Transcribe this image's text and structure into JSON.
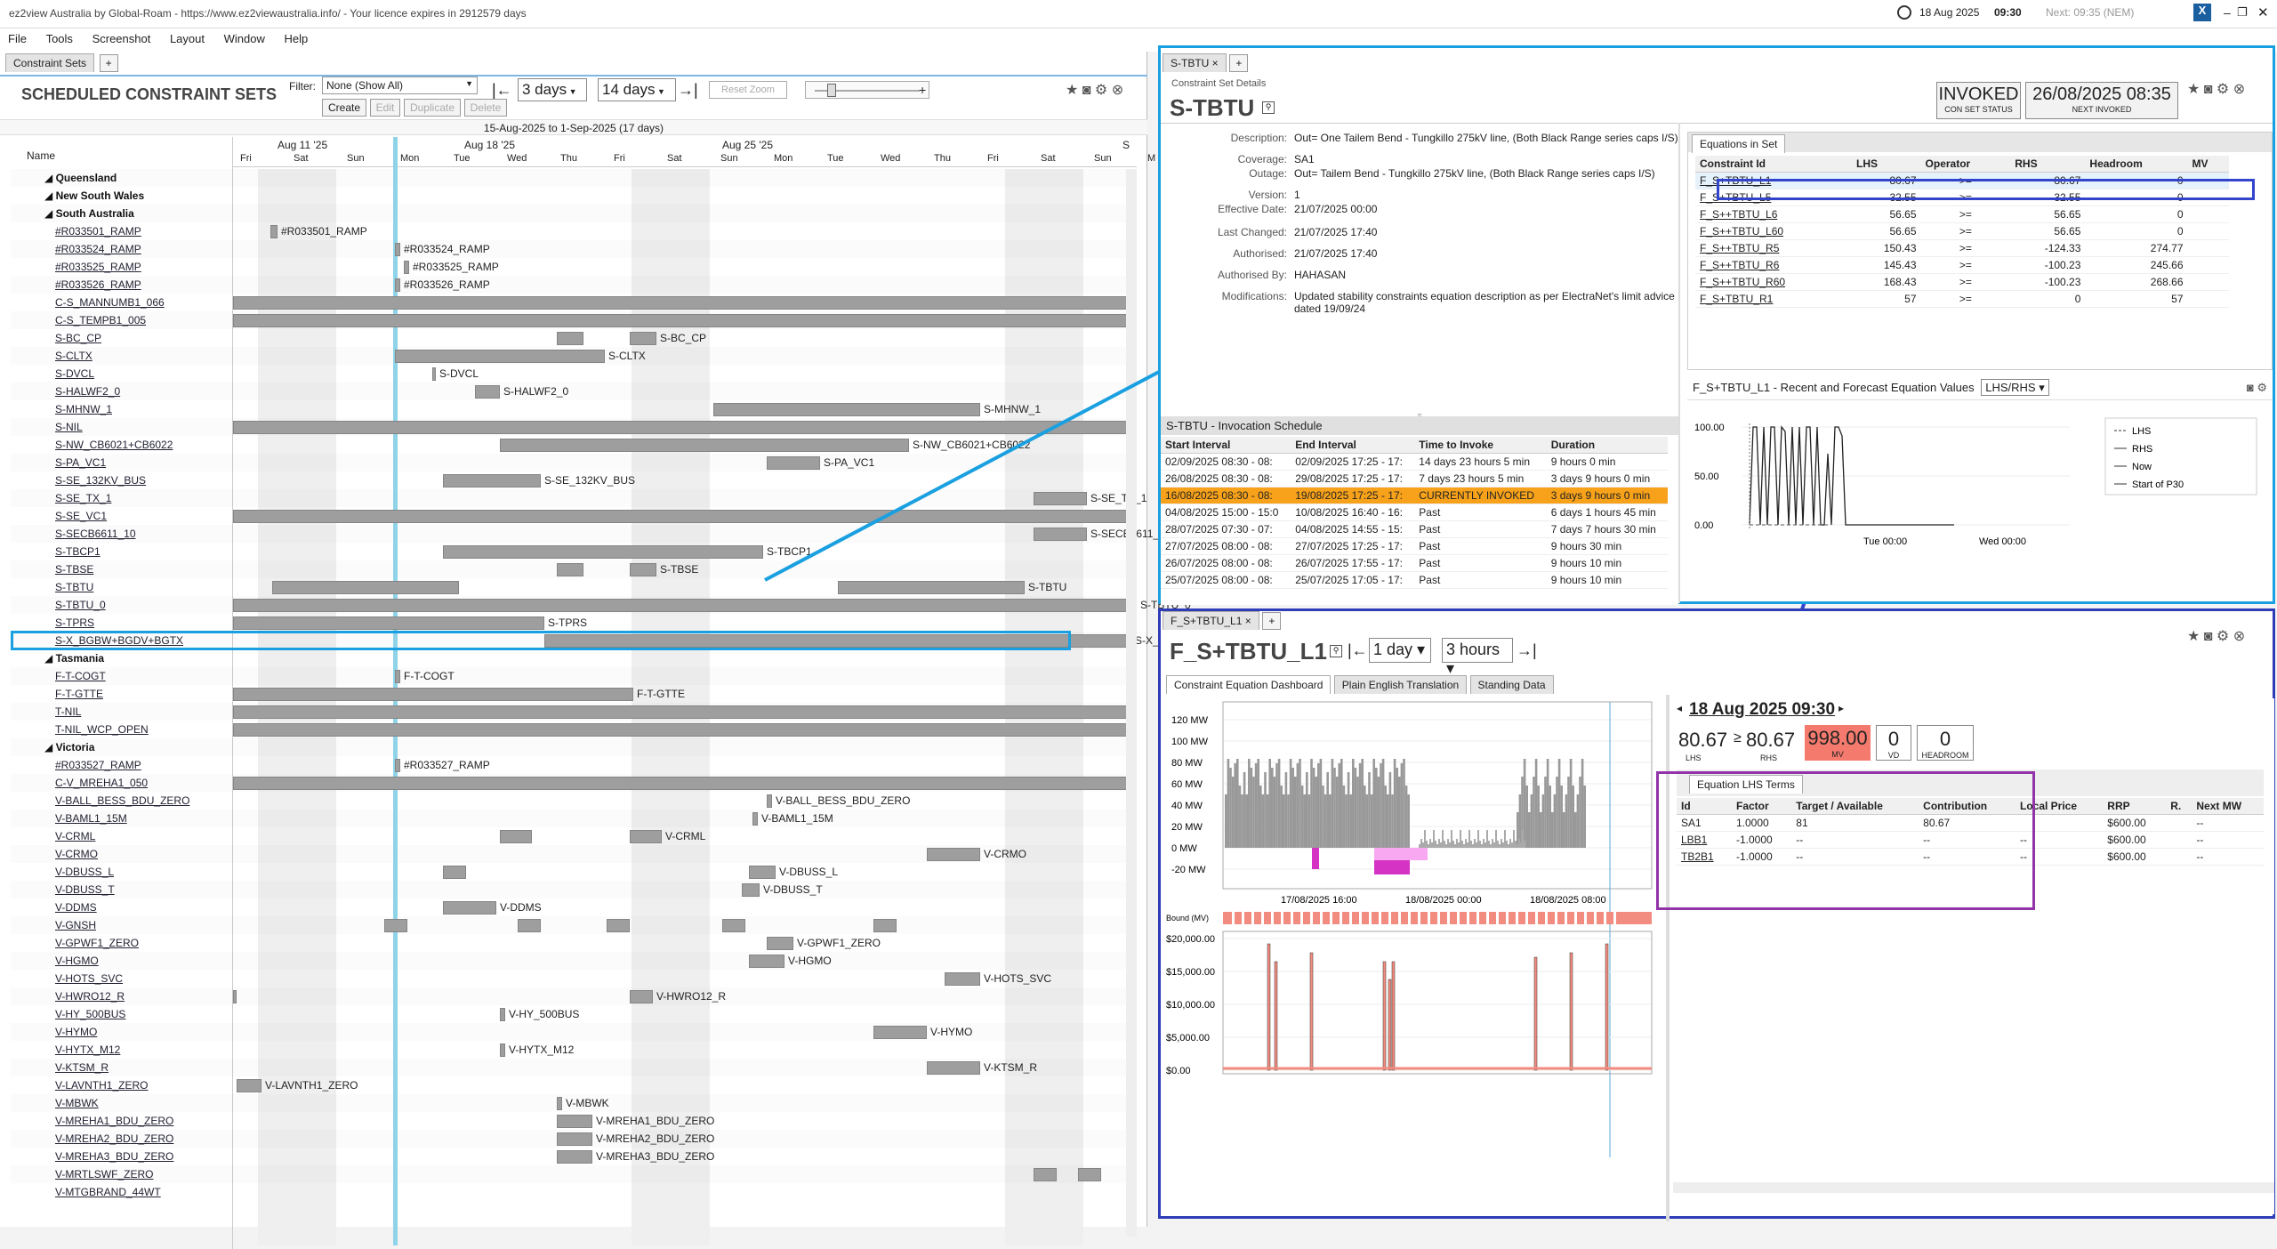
{
  "app": {
    "title": "ez2view Australia by Global-Roam - https://www.ez2viewaustralia.info/ - Your licence expires in 2912579 days",
    "clock_date": "18 Aug 2025",
    "clock_time": "09:30",
    "next_label": "Next: 09:35 (NEM)"
  },
  "menu": [
    "File",
    "Tools",
    "Screenshot",
    "Layout",
    "Window",
    "Help"
  ],
  "left": {
    "tab": "Constraint Sets",
    "heading": "SCHEDULED CONSTRAINT SETS",
    "filter_label": "Filter:",
    "filter_value": "None (Show All)",
    "buttons": [
      "Create",
      "Edit",
      "Duplicate",
      "Delete"
    ],
    "range1": "3 days",
    "range2": "14 days",
    "reset_zoom": "Reset Zoom",
    "date_range": "15-Aug-2025 to 1-Sep-2025 (17 days)",
    "name_col": "Name",
    "weeks": [
      "Aug 11 '25",
      "Aug 18 '25",
      "Aug 25 '25",
      "S"
    ],
    "days": [
      "Fri",
      "Sat",
      "Sun",
      "Mon",
      "Tue",
      "Wed",
      "Thu",
      "Fri",
      "Sat",
      "Sun",
      "Mon",
      "Tue",
      "Wed",
      "Thu",
      "Fri",
      "Sat",
      "Sun",
      "M"
    ],
    "rows": [
      {
        "t": "Queensland",
        "r": 1
      },
      {
        "t": "New South Wales",
        "r": 1
      },
      {
        "t": "South Australia",
        "r": 1
      },
      {
        "t": "#R033501_RAMP"
      },
      {
        "t": "#R033524_RAMP"
      },
      {
        "t": "#R033525_RAMP"
      },
      {
        "t": "#R033526_RAMP"
      },
      {
        "t": "C-S_MANNUMB1_066"
      },
      {
        "t": "C-S_TEMPB1_005"
      },
      {
        "t": "S-BC_CP"
      },
      {
        "t": "S-CLTX"
      },
      {
        "t": "S-DVCL"
      },
      {
        "t": "S-HALWF2_0"
      },
      {
        "t": "S-MHNW_1"
      },
      {
        "t": "S-NIL"
      },
      {
        "t": "S-NW_CB6021+CB6022"
      },
      {
        "t": "S-PA_VC1"
      },
      {
        "t": "S-SE_132KV_BUS"
      },
      {
        "t": "S-SE_TX_1"
      },
      {
        "t": "S-SE_VC1"
      },
      {
        "t": "S-SECB6611_10"
      },
      {
        "t": "S-TBCP1"
      },
      {
        "t": "S-TBSE"
      },
      {
        "t": "S-TBTU"
      },
      {
        "t": "S-TBTU_0"
      },
      {
        "t": "S-TPRS"
      },
      {
        "t": "S-X_BGBW+BGDV+BGTX"
      },
      {
        "t": "Tasmania",
        "r": 1
      },
      {
        "t": "F-T-COGT"
      },
      {
        "t": "F-T-GTTE"
      },
      {
        "t": "T-NIL"
      },
      {
        "t": "T-NIL_WCP_OPEN"
      },
      {
        "t": "Victoria",
        "r": 1
      },
      {
        "t": "#R033527_RAMP"
      },
      {
        "t": "C-V_MREHA1_050"
      },
      {
        "t": "V-BALL_BESS_BDU_ZERO"
      },
      {
        "t": "V-BAML1_15M"
      },
      {
        "t": "V-CRML"
      },
      {
        "t": "V-CRMO"
      },
      {
        "t": "V-DBUSS_L"
      },
      {
        "t": "V-DBUSS_T"
      },
      {
        "t": "V-DDMS"
      },
      {
        "t": "V-GNSH"
      },
      {
        "t": "V-GPWF1_ZERO"
      },
      {
        "t": "V-HGMO"
      },
      {
        "t": "V-HOTS_SVC"
      },
      {
        "t": "V-HWRO12_R"
      },
      {
        "t": "V-HY_500BUS"
      },
      {
        "t": "V-HYMO"
      },
      {
        "t": "V-HYTX_M12"
      },
      {
        "t": "V-KTSM_R"
      },
      {
        "t": "V-LAVNTH1_ZERO"
      },
      {
        "t": "V-MBWK"
      },
      {
        "t": "V-MREHA1_BDU_ZERO"
      },
      {
        "t": "V-MREHA2_BDU_ZERO"
      },
      {
        "t": "V-MREHA3_BDU_ZERO"
      },
      {
        "t": "V-MRTLSWF_ZERO"
      },
      {
        "t": "V-MTGBRAND_44WT"
      }
    ]
  },
  "setdetail": {
    "tab": "S-TBTU",
    "breadcrumb": "Constraint Set Details",
    "title": "S-TBTU",
    "status": "INVOKED",
    "status_lbl": "CON SET STATUS",
    "next_inv": "26/08/2025 08:35",
    "next_inv_lbl": "NEXT INVOKED",
    "fields": [
      {
        "k": "Description:",
        "v": "Out= One Tailem Bend - Tungkillo 275kV line, (Both Black Range series caps I/S)"
      },
      {
        "k": "Coverage:",
        "v": "SA1"
      },
      {
        "k": "Outage:",
        "v": "Out= Tailem Bend - Tungkillo 275kV line, (Both Black Range series caps I/S)"
      },
      {
        "k": "Version:",
        "v": "1"
      },
      {
        "k": "Effective Date:",
        "v": "21/07/2025 00:00"
      },
      {
        "k": "Last Changed:",
        "v": "21/07/2025 17:40"
      },
      {
        "k": "Authorised:",
        "v": "21/07/2025 17:40"
      },
      {
        "k": "Authorised By:",
        "v": "HAHASAN"
      },
      {
        "k": "Modifications:",
        "v": "Updated stability constraints equation description as per ElectraNet's limit advice dated 19/09/24"
      }
    ],
    "inv_title": "S-TBTU - Invocation Schedule",
    "inv_cols": [
      "Start Interval",
      "End Interval",
      "Time to Invoke",
      "Duration"
    ],
    "inv_rows": [
      [
        "02/09/2025 08:30 - 08:",
        "02/09/2025 17:25 - 17:",
        "14 days 23 hours 5 min",
        "9 hours 0 min"
      ],
      [
        "26/08/2025 08:30 - 08:",
        "29/08/2025 17:25 - 17:",
        "7 days 23 hours 5 min",
        "3 days 9 hours 0 min"
      ],
      [
        "16/08/2025 08:30 - 08:",
        "19/08/2025 17:25 - 17:",
        "CURRENTLY INVOKED",
        "3 days 9 hours 0 min"
      ],
      [
        "04/08/2025 15:00 - 15:0",
        "10/08/2025 16:40 - 16:",
        "Past",
        "6 days 1 hours 45 min"
      ],
      [
        "28/07/2025 07:30 - 07:",
        "04/08/2025 14:55 - 15:",
        "Past",
        "7 days 7 hours 30 min"
      ],
      [
        "27/07/2025 08:00 - 08:",
        "27/07/2025 17:25 - 17:",
        "Past",
        "9 hours 30 min"
      ],
      [
        "26/07/2025 08:00 - 08:",
        "26/07/2025 17:55 - 17:",
        "Past",
        "9 hours 10 min"
      ],
      [
        "25/07/2025 08:00 - 08:",
        "25/07/2025 17:05 - 17:",
        "Past",
        "9 hours 10 min"
      ]
    ],
    "eq_tab": "Equations in Set",
    "eq_cols": [
      "Constraint Id",
      "LHS",
      "Operator",
      "RHS",
      "Headroom",
      "MV"
    ],
    "eq_rows": [
      [
        "F_S+TBTU_L1",
        "80.67",
        ">=",
        "80.67",
        "0",
        ""
      ],
      [
        "F_S+TBTU_L5",
        "32.55",
        ">=",
        "32.55",
        "0",
        ""
      ],
      [
        "F_S++TBTU_L6",
        "56.65",
        ">=",
        "56.65",
        "0",
        ""
      ],
      [
        "F_S++TBTU_L60",
        "56.65",
        ">=",
        "56.65",
        "0",
        ""
      ],
      [
        "F_S++TBTU_R5",
        "150.43",
        ">=",
        "-124.33",
        "274.77",
        ""
      ],
      [
        "F_S++TBTU_R6",
        "145.43",
        ">=",
        "-100.23",
        "245.66",
        ""
      ],
      [
        "F_S++TBTU_R60",
        "168.43",
        ">=",
        "-100.23",
        "268.66",
        ""
      ],
      [
        "F_S+TBTU_R1",
        "57",
        ">=",
        "0",
        "57",
        ""
      ]
    ],
    "mini_title": "F_S+TBTU_L1 - Recent and Forecast Equation Values",
    "mini_sel": "LHS/RHS",
    "mini_y": [
      "100.00",
      "50.00",
      "0.00"
    ],
    "mini_x": [
      "Tue 00:00",
      "Wed 00:00"
    ],
    "mini_legend": [
      "LHS",
      "RHS",
      "Now",
      "Start of P30"
    ]
  },
  "equation": {
    "tab": "F_S+TBTU_L1",
    "title": "F_S+TBTU_L1",
    "range1": "1 day",
    "range2": "3 hours",
    "subtabs": [
      "Constraint Equation Dashboard",
      "Plain English Translation",
      "Standing Data"
    ],
    "date": "18 Aug 2025 09:30",
    "lhs": "80.67",
    "op": "≥",
    "rhs": "80.67",
    "mv": "998.00",
    "vd": "0",
    "headroom": "0",
    "lhs_l": "LHS",
    "rhs_l": "RHS",
    "mv_l": "MV",
    "vd_l": "VD",
    "hr_l": "HEADROOM",
    "yaxis": [
      "120 MW",
      "100 MW",
      "80 MW",
      "60 MW",
      "40 MW",
      "20 MW",
      "0 MW",
      "-20 MW"
    ],
    "xaxis": [
      "17/08/2025 16:00",
      "18/08/2025 00:00",
      "18/08/2025 08:00"
    ],
    "bound_lbl": "Bound (MV)",
    "price_axis": [
      "$20,000.00",
      "$15,000.00",
      "$10,000.00",
      "$5,000.00",
      "$0.00"
    ],
    "terms_tab": "Equation LHS Terms",
    "terms_cols": [
      "Id",
      "Factor",
      "Target / Available",
      "Contribution",
      "Local Price",
      "RRP",
      "R.",
      "Next MW"
    ],
    "terms_rows": [
      [
        "SA1",
        "1.0000",
        "81",
        "80.67",
        "",
        "$600.00",
        "",
        "--"
      ],
      [
        "LBB1",
        "-1.0000",
        "--",
        "--",
        "--",
        "$600.00",
        "",
        "--"
      ],
      [
        "TB2B1",
        "-1.0000",
        "--",
        "--",
        "--",
        "$600.00",
        "",
        "--"
      ]
    ]
  }
}
